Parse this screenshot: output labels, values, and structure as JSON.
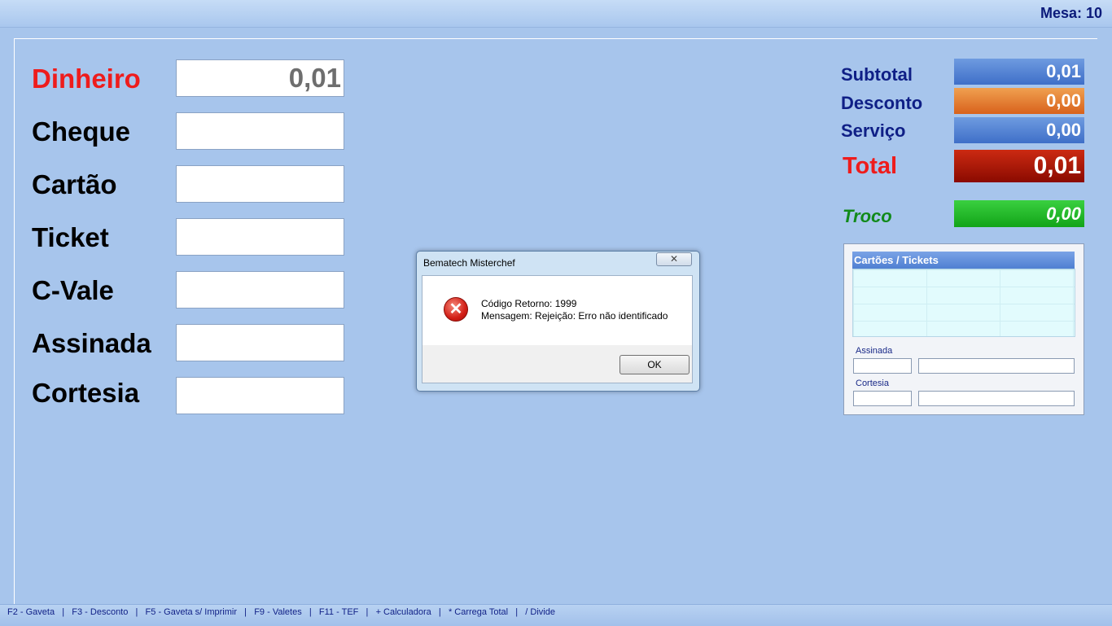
{
  "header": {
    "mesa": "Mesa: 10"
  },
  "payments": [
    {
      "label": "Dinheiro",
      "value": "0,01"
    },
    {
      "label": "Cheque",
      "value": ""
    },
    {
      "label": "Cartão",
      "value": ""
    },
    {
      "label": "Ticket",
      "value": ""
    },
    {
      "label": "C-Vale",
      "value": ""
    },
    {
      "label": "Assinada",
      "value": ""
    },
    {
      "label": "Cortesia",
      "value": ""
    }
  ],
  "summary": {
    "subtotal_label": "Subtotal",
    "subtotal_value": "0,01",
    "desconto_label": "Desconto",
    "desconto_value": "0,00",
    "servico_label": "Serviço",
    "servico_value": "0,00",
    "total_label": "Total",
    "total_value": "0,01",
    "troco_label": "Troco",
    "troco_value": "0,00"
  },
  "cards_panel": {
    "title": "Cartões / Tickets",
    "assinada_label": "Assinada",
    "cortesia_label": "Cortesia"
  },
  "dialog": {
    "title": "Bematech Misterchef",
    "close_glyph": "✕",
    "line1": "Código Retorno: 1999",
    "line2": "Mensagem: Rejeição: Erro não identificado",
    "ok_label": "OK",
    "icon": "error-icon"
  },
  "footer": {
    "shortcuts": "F2 - Gaveta   |   F3 - Desconto   |   F5 - Gaveta s/ Imprimir   |   F9 - Valetes   |   F11 - TEF   |   + Calculadora   |   * Carrega Total   |   / Divide"
  },
  "colors": {
    "background": "#a7c5ec",
    "label_navy": "#0f1f86",
    "accent_red": "#ee1c1c",
    "troco_green": "#118a1a"
  }
}
